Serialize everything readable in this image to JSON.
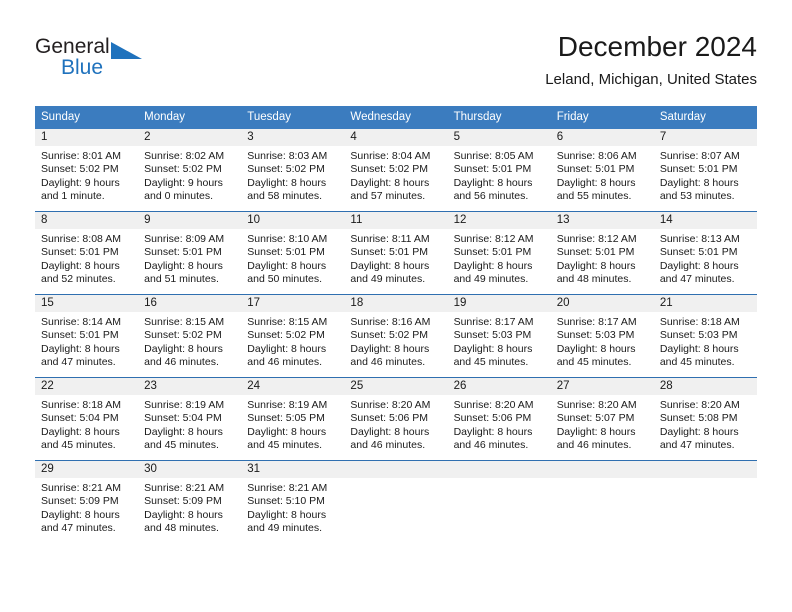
{
  "brand": {
    "name_top": "General",
    "name_bottom": "Blue",
    "accent_color": "#1f72bd",
    "logo_icon": "triangle-icon"
  },
  "header": {
    "title": "December 2024",
    "subtitle": "Leland, Michigan, United States"
  },
  "theme": {
    "header_row_bg": "#3b7cbf",
    "day_band_bg": "#f0f0f0",
    "row_divider": "#2f6fb0",
    "text": "#1a1a1a"
  },
  "weekday_headers": [
    "Sunday",
    "Monday",
    "Tuesday",
    "Wednesday",
    "Thursday",
    "Friday",
    "Saturday"
  ],
  "weeks": [
    [
      {
        "day": "1",
        "sunrise": "Sunrise: 8:01 AM",
        "sunset": "Sunset: 5:02 PM",
        "daylight_line1": "Daylight: 9 hours",
        "daylight_line2": "and 1 minute."
      },
      {
        "day": "2",
        "sunrise": "Sunrise: 8:02 AM",
        "sunset": "Sunset: 5:02 PM",
        "daylight_line1": "Daylight: 9 hours",
        "daylight_line2": "and 0 minutes."
      },
      {
        "day": "3",
        "sunrise": "Sunrise: 8:03 AM",
        "sunset": "Sunset: 5:02 PM",
        "daylight_line1": "Daylight: 8 hours",
        "daylight_line2": "and 58 minutes."
      },
      {
        "day": "4",
        "sunrise": "Sunrise: 8:04 AM",
        "sunset": "Sunset: 5:02 PM",
        "daylight_line1": "Daylight: 8 hours",
        "daylight_line2": "and 57 minutes."
      },
      {
        "day": "5",
        "sunrise": "Sunrise: 8:05 AM",
        "sunset": "Sunset: 5:01 PM",
        "daylight_line1": "Daylight: 8 hours",
        "daylight_line2": "and 56 minutes."
      },
      {
        "day": "6",
        "sunrise": "Sunrise: 8:06 AM",
        "sunset": "Sunset: 5:01 PM",
        "daylight_line1": "Daylight: 8 hours",
        "daylight_line2": "and 55 minutes."
      },
      {
        "day": "7",
        "sunrise": "Sunrise: 8:07 AM",
        "sunset": "Sunset: 5:01 PM",
        "daylight_line1": "Daylight: 8 hours",
        "daylight_line2": "and 53 minutes."
      }
    ],
    [
      {
        "day": "8",
        "sunrise": "Sunrise: 8:08 AM",
        "sunset": "Sunset: 5:01 PM",
        "daylight_line1": "Daylight: 8 hours",
        "daylight_line2": "and 52 minutes."
      },
      {
        "day": "9",
        "sunrise": "Sunrise: 8:09 AM",
        "sunset": "Sunset: 5:01 PM",
        "daylight_line1": "Daylight: 8 hours",
        "daylight_line2": "and 51 minutes."
      },
      {
        "day": "10",
        "sunrise": "Sunrise: 8:10 AM",
        "sunset": "Sunset: 5:01 PM",
        "daylight_line1": "Daylight: 8 hours",
        "daylight_line2": "and 50 minutes."
      },
      {
        "day": "11",
        "sunrise": "Sunrise: 8:11 AM",
        "sunset": "Sunset: 5:01 PM",
        "daylight_line1": "Daylight: 8 hours",
        "daylight_line2": "and 49 minutes."
      },
      {
        "day": "12",
        "sunrise": "Sunrise: 8:12 AM",
        "sunset": "Sunset: 5:01 PM",
        "daylight_line1": "Daylight: 8 hours",
        "daylight_line2": "and 49 minutes."
      },
      {
        "day": "13",
        "sunrise": "Sunrise: 8:12 AM",
        "sunset": "Sunset: 5:01 PM",
        "daylight_line1": "Daylight: 8 hours",
        "daylight_line2": "and 48 minutes."
      },
      {
        "day": "14",
        "sunrise": "Sunrise: 8:13 AM",
        "sunset": "Sunset: 5:01 PM",
        "daylight_line1": "Daylight: 8 hours",
        "daylight_line2": "and 47 minutes."
      }
    ],
    [
      {
        "day": "15",
        "sunrise": "Sunrise: 8:14 AM",
        "sunset": "Sunset: 5:01 PM",
        "daylight_line1": "Daylight: 8 hours",
        "daylight_line2": "and 47 minutes."
      },
      {
        "day": "16",
        "sunrise": "Sunrise: 8:15 AM",
        "sunset": "Sunset: 5:02 PM",
        "daylight_line1": "Daylight: 8 hours",
        "daylight_line2": "and 46 minutes."
      },
      {
        "day": "17",
        "sunrise": "Sunrise: 8:15 AM",
        "sunset": "Sunset: 5:02 PM",
        "daylight_line1": "Daylight: 8 hours",
        "daylight_line2": "and 46 minutes."
      },
      {
        "day": "18",
        "sunrise": "Sunrise: 8:16 AM",
        "sunset": "Sunset: 5:02 PM",
        "daylight_line1": "Daylight: 8 hours",
        "daylight_line2": "and 46 minutes."
      },
      {
        "day": "19",
        "sunrise": "Sunrise: 8:17 AM",
        "sunset": "Sunset: 5:03 PM",
        "daylight_line1": "Daylight: 8 hours",
        "daylight_line2": "and 45 minutes."
      },
      {
        "day": "20",
        "sunrise": "Sunrise: 8:17 AM",
        "sunset": "Sunset: 5:03 PM",
        "daylight_line1": "Daylight: 8 hours",
        "daylight_line2": "and 45 minutes."
      },
      {
        "day": "21",
        "sunrise": "Sunrise: 8:18 AM",
        "sunset": "Sunset: 5:03 PM",
        "daylight_line1": "Daylight: 8 hours",
        "daylight_line2": "and 45 minutes."
      }
    ],
    [
      {
        "day": "22",
        "sunrise": "Sunrise: 8:18 AM",
        "sunset": "Sunset: 5:04 PM",
        "daylight_line1": "Daylight: 8 hours",
        "daylight_line2": "and 45 minutes."
      },
      {
        "day": "23",
        "sunrise": "Sunrise: 8:19 AM",
        "sunset": "Sunset: 5:04 PM",
        "daylight_line1": "Daylight: 8 hours",
        "daylight_line2": "and 45 minutes."
      },
      {
        "day": "24",
        "sunrise": "Sunrise: 8:19 AM",
        "sunset": "Sunset: 5:05 PM",
        "daylight_line1": "Daylight: 8 hours",
        "daylight_line2": "and 45 minutes."
      },
      {
        "day": "25",
        "sunrise": "Sunrise: 8:20 AM",
        "sunset": "Sunset: 5:06 PM",
        "daylight_line1": "Daylight: 8 hours",
        "daylight_line2": "and 46 minutes."
      },
      {
        "day": "26",
        "sunrise": "Sunrise: 8:20 AM",
        "sunset": "Sunset: 5:06 PM",
        "daylight_line1": "Daylight: 8 hours",
        "daylight_line2": "and 46 minutes."
      },
      {
        "day": "27",
        "sunrise": "Sunrise: 8:20 AM",
        "sunset": "Sunset: 5:07 PM",
        "daylight_line1": "Daylight: 8 hours",
        "daylight_line2": "and 46 minutes."
      },
      {
        "day": "28",
        "sunrise": "Sunrise: 8:20 AM",
        "sunset": "Sunset: 5:08 PM",
        "daylight_line1": "Daylight: 8 hours",
        "daylight_line2": "and 47 minutes."
      }
    ],
    [
      {
        "day": "29",
        "sunrise": "Sunrise: 8:21 AM",
        "sunset": "Sunset: 5:09 PM",
        "daylight_line1": "Daylight: 8 hours",
        "daylight_line2": "and 47 minutes."
      },
      {
        "day": "30",
        "sunrise": "Sunrise: 8:21 AM",
        "sunset": "Sunset: 5:09 PM",
        "daylight_line1": "Daylight: 8 hours",
        "daylight_line2": "and 48 minutes."
      },
      {
        "day": "31",
        "sunrise": "Sunrise: 8:21 AM",
        "sunset": "Sunset: 5:10 PM",
        "daylight_line1": "Daylight: 8 hours",
        "daylight_line2": "and 49 minutes."
      },
      {
        "day": "",
        "sunrise": "",
        "sunset": "",
        "daylight_line1": "",
        "daylight_line2": ""
      },
      {
        "day": "",
        "sunrise": "",
        "sunset": "",
        "daylight_line1": "",
        "daylight_line2": ""
      },
      {
        "day": "",
        "sunrise": "",
        "sunset": "",
        "daylight_line1": "",
        "daylight_line2": ""
      },
      {
        "day": "",
        "sunrise": "",
        "sunset": "",
        "daylight_line1": "",
        "daylight_line2": ""
      }
    ]
  ]
}
